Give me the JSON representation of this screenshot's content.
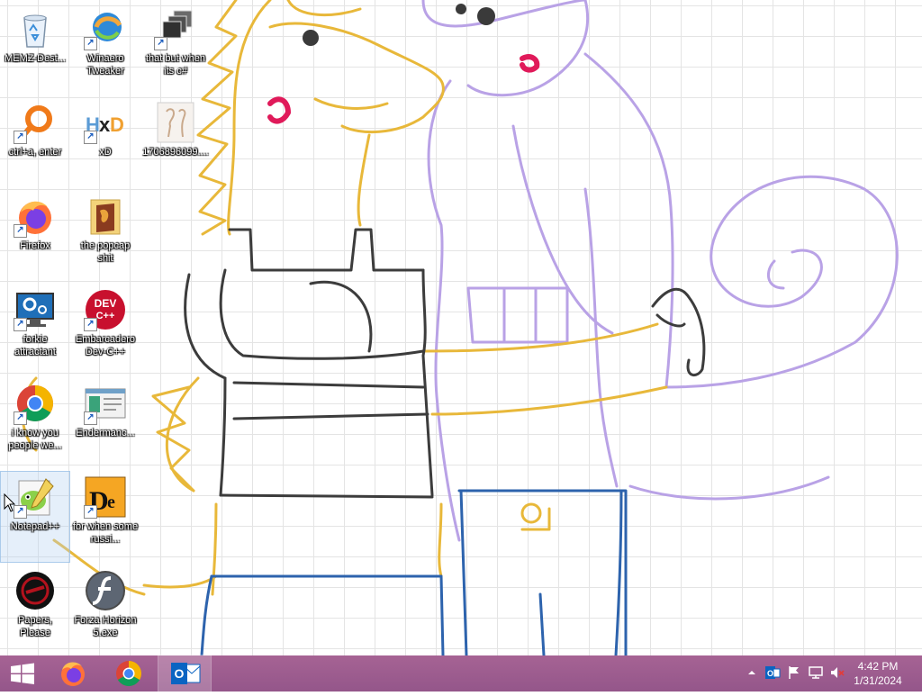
{
  "desktop": {
    "icons": [
      {
        "label": "MEMZ-Dest...",
        "icon": "recycle-bin-icon"
      },
      {
        "label": "Winaero Tweaker",
        "icon": "winaero-tweaker-icon"
      },
      {
        "label": "that but when its c#",
        "icon": "stacked-windows-icon"
      },
      {
        "label": "ctrl+a, enter",
        "icon": "magnifier-ring-icon"
      },
      {
        "label": "xD",
        "icon": "hxd-icon"
      },
      {
        "label": "1706896099....",
        "icon": "image-file-icon"
      },
      {
        "label": "Firefox",
        "icon": "firefox-icon"
      },
      {
        "label": "the popcap shit",
        "icon": "folder-icon"
      },
      {
        "label": "forkie attractant",
        "icon": "computer-settings-icon"
      },
      {
        "label": "Embarcadero Dev-C++",
        "icon": "dev-cpp-icon"
      },
      {
        "label": "i know you people we...",
        "icon": "chrome-icon"
      },
      {
        "label": "Endermanc...",
        "icon": "window-app-icon"
      },
      {
        "label": "Notepad++",
        "icon": "notepad-plus-plus-icon"
      },
      {
        "label": "for when some russi...",
        "icon": "de-app-icon"
      },
      {
        "label": "Papers, Please",
        "icon": "papers-please-icon"
      },
      {
        "label": "Forza Horizon 5.exe",
        "icon": "flash-icon"
      }
    ]
  },
  "taskbar": {
    "start": "start-button",
    "pinned": [
      "firefox-icon",
      "chrome-icon",
      "outlook-icon"
    ],
    "tray": [
      "show-hidden-icons-chevron",
      "outlook-tray-icon",
      "action-center-flag-icon",
      "network-icon",
      "volume-muted-icon"
    ],
    "time": "4:42 PM",
    "date": "1/31/2024"
  },
  "colors": {
    "taskbar": "#9c5a8a",
    "yellow_lizard": "#e8b83a",
    "purple_lizard": "#b9a2e6",
    "dark_outline": "#3c3c3c",
    "jeans": "#2d63ad",
    "blush": "#e01a5a"
  }
}
